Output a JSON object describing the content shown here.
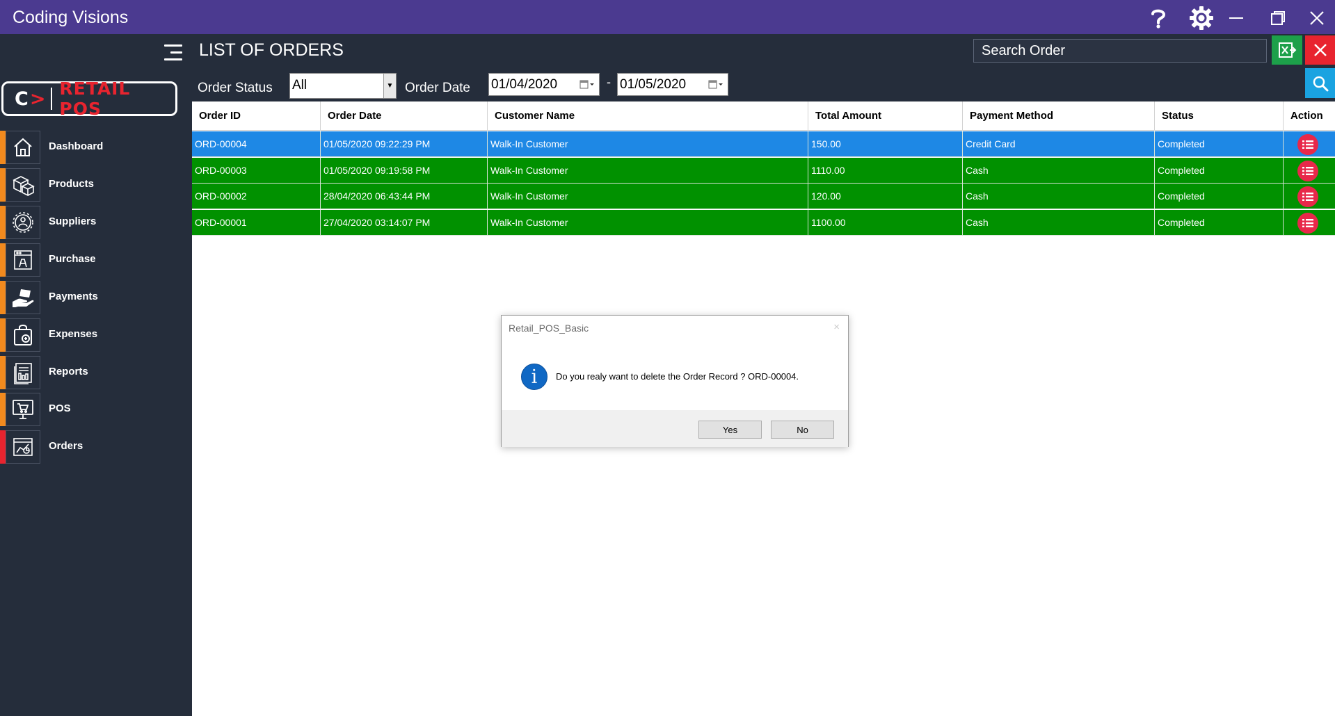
{
  "window": {
    "title": "Coding Visions"
  },
  "logo": {
    "mark_c": "C",
    "mark_arrow": ">",
    "text": "RETAIL POS"
  },
  "sidebar": {
    "items": [
      {
        "label": "Dashboard",
        "icon": "home-icon",
        "active": false
      },
      {
        "label": "Products",
        "icon": "boxes-icon",
        "active": false
      },
      {
        "label": "Suppliers",
        "icon": "gear-people-icon",
        "active": false
      },
      {
        "label": "Purchase",
        "icon": "purchase-icon",
        "active": false
      },
      {
        "label": "Payments",
        "icon": "payment-hand-icon",
        "active": false
      },
      {
        "label": "Expenses",
        "icon": "bag-icon",
        "active": false
      },
      {
        "label": "Reports",
        "icon": "report-icon",
        "active": false
      },
      {
        "label": "POS",
        "icon": "monitor-cart-icon",
        "active": false
      },
      {
        "label": "Orders",
        "icon": "orders-chart-icon",
        "active": true
      }
    ]
  },
  "header": {
    "title": "LIST OF ORDERS",
    "search_placeholder": "Search Order"
  },
  "filters": {
    "status_label": "Order Status",
    "status_value": "All",
    "date_label": "Order Date",
    "date_from": "01/04/2020",
    "date_separator": "-",
    "date_to": "01/05/2020"
  },
  "grid": {
    "columns": [
      "Order ID",
      "Order Date",
      "Customer Name",
      "Total Amount",
      "Payment Method",
      "Status",
      "Action"
    ],
    "rows": [
      {
        "order_id": "ORD-00004",
        "order_date": "01/05/2020 09:22:29 PM",
        "customer": "Walk-In Customer",
        "total": "150.00",
        "payment": "Credit Card",
        "status": "Completed",
        "selected": true
      },
      {
        "order_id": "ORD-00003",
        "order_date": "01/05/2020 09:19:58 PM",
        "customer": "Walk-In Customer",
        "total": "1110.00",
        "payment": "Cash",
        "status": "Completed",
        "selected": false
      },
      {
        "order_id": "ORD-00002",
        "order_date": "28/04/2020 06:43:44 PM",
        "customer": "Walk-In Customer",
        "total": "120.00",
        "payment": "Cash",
        "status": "Completed",
        "selected": false
      },
      {
        "order_id": "ORD-00001",
        "order_date": "27/04/2020 03:14:07 PM",
        "customer": "Walk-In Customer",
        "total": "1100.00",
        "payment": "Cash",
        "status": "Completed",
        "selected": false
      }
    ]
  },
  "dialog": {
    "title": "Retail_POS_Basic",
    "close": "×",
    "info_glyph": "i",
    "message": "Do you realy want to delete the Order Record ? ORD-00004.",
    "yes_label": "Yes",
    "no_label": "No"
  },
  "colors": {
    "titlebar": "#4b3a90",
    "sidebar": "#252d3b",
    "row_selected": "#1e88e5",
    "row_completed": "#019100",
    "accent_orange": "#f28a1e",
    "accent_red": "#e8242f",
    "export_green": "#1da04a",
    "search_blue": "#1aa3e1"
  }
}
